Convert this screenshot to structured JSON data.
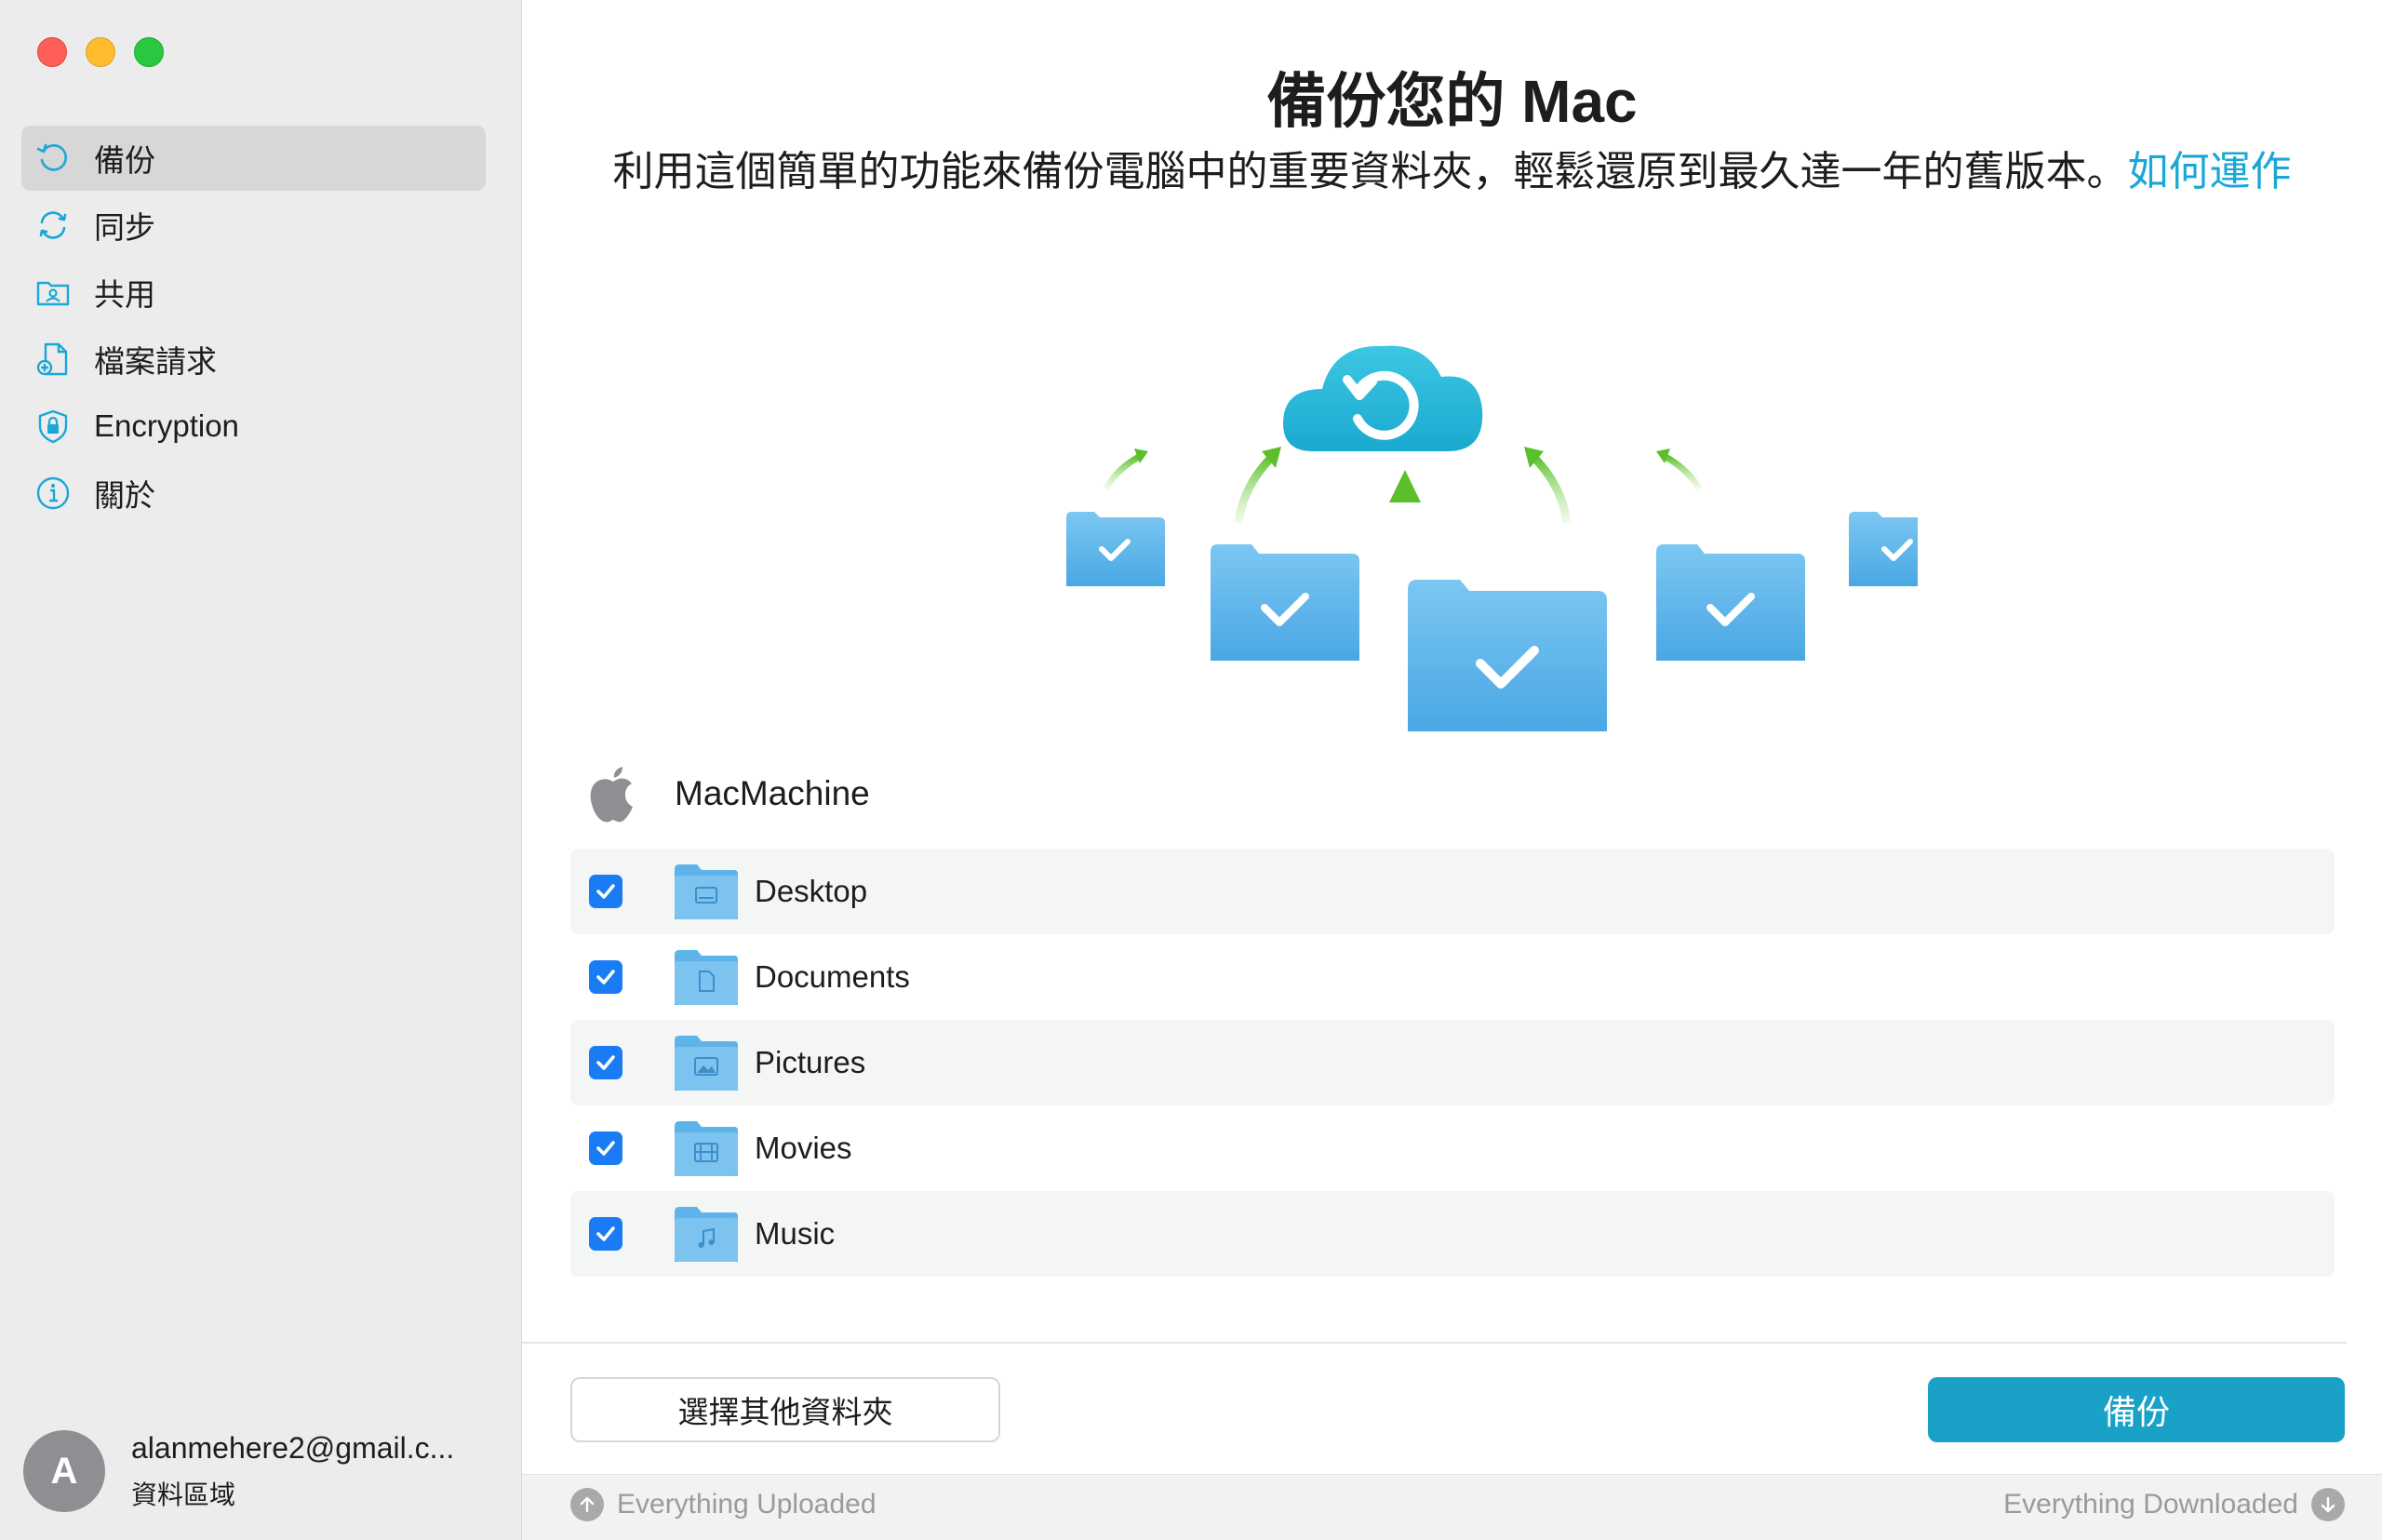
{
  "window": {
    "controls": [
      "close",
      "minimize",
      "maximize"
    ]
  },
  "sidebar": {
    "items": [
      {
        "label": "備份",
        "icon": "backup-clock-icon",
        "active": true
      },
      {
        "label": "同步",
        "icon": "sync-icon",
        "active": false
      },
      {
        "label": "共用",
        "icon": "share-folder-icon",
        "active": false
      },
      {
        "label": "檔案請求",
        "icon": "file-request-icon",
        "active": false
      },
      {
        "label": "Encryption",
        "icon": "lock-shield-icon",
        "active": false
      },
      {
        "label": "關於",
        "icon": "info-icon",
        "active": false
      }
    ],
    "account": {
      "avatar_letter": "A",
      "email": "alanmehere2@gmail.c...",
      "region": "資料區域"
    }
  },
  "main": {
    "title": "備份您的 Mac",
    "subtitle": "利用這個簡單的功能來備份電腦中的重要資料夾，輕鬆還原到最久達一年的舊版本。",
    "link": "如何運作",
    "device_name": "MacMachine",
    "folders": [
      {
        "name": "Desktop",
        "checked": true,
        "icon": "desktop-folder-icon"
      },
      {
        "name": "Documents",
        "checked": true,
        "icon": "documents-folder-icon"
      },
      {
        "name": "Pictures",
        "checked": true,
        "icon": "pictures-folder-icon"
      },
      {
        "name": "Movies",
        "checked": true,
        "icon": "movies-folder-icon"
      },
      {
        "name": "Music",
        "checked": true,
        "icon": "music-folder-icon"
      }
    ],
    "choose_button": "選擇其他資料夾",
    "backup_button": "備份"
  },
  "status": {
    "uploaded": "Everything Uploaded",
    "downloaded": "Everything Downloaded"
  },
  "colors": {
    "accent": "#1aa1c8",
    "link": "#1aa7d6",
    "checkbox": "#1a7cf5",
    "folder": "#5eb4ea",
    "arrow": "#6cc837",
    "cloud": "#22b7d6"
  }
}
